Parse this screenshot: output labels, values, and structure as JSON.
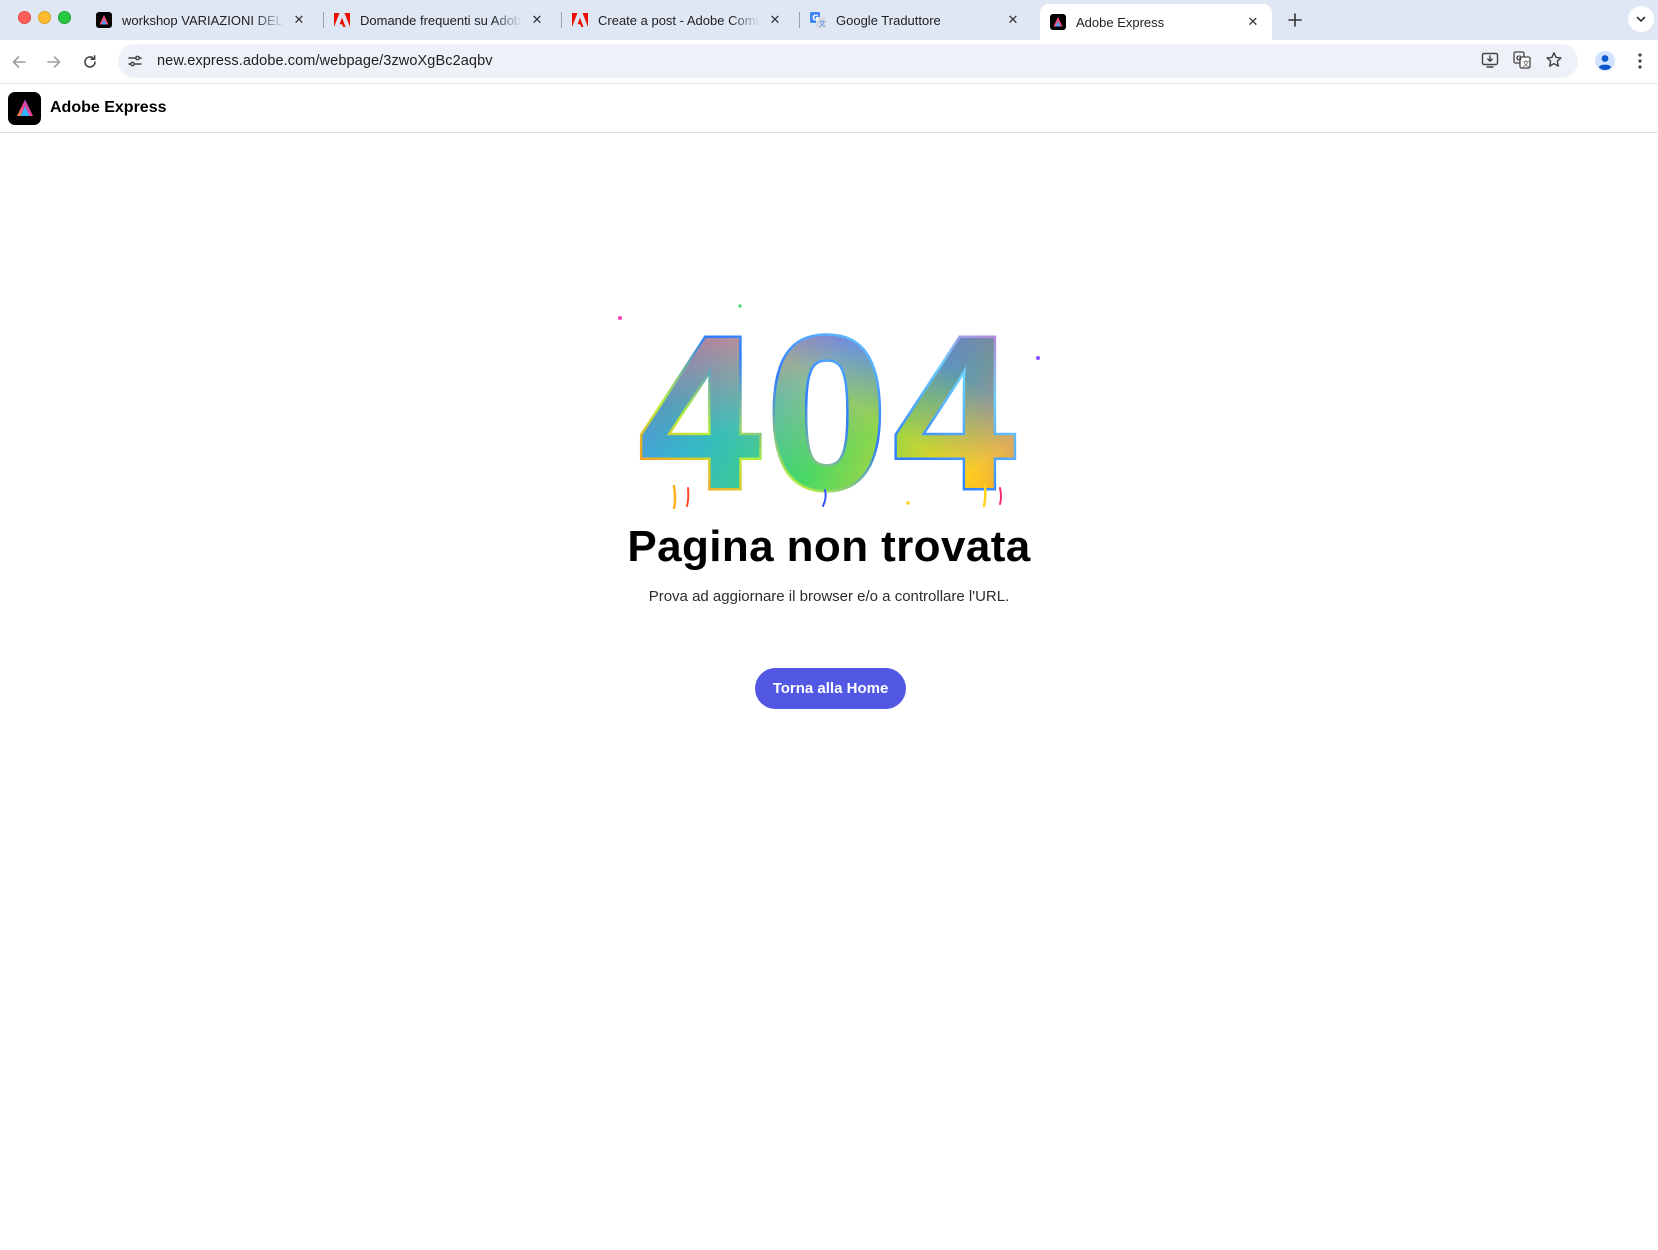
{
  "browser": {
    "tabs": [
      {
        "title": "workshop VARIAZIONI DEL PA",
        "favicon": "adobe-express-icon",
        "active": false
      },
      {
        "title": "Domande frequenti su Adobe",
        "favicon": "adobe-icon",
        "active": false
      },
      {
        "title": "Create a post - Adobe Comm",
        "favicon": "adobe-icon",
        "active": false
      },
      {
        "title": "Google Traduttore",
        "favicon": "google-translate-icon",
        "active": false
      },
      {
        "title": "Adobe Express",
        "favicon": "adobe-express-icon",
        "active": true
      }
    ],
    "url": "new.express.adobe.com/webpage/3zwoXgBc2aqbv"
  },
  "site": {
    "brand_name": "Adobe Express"
  },
  "error_page": {
    "code": "404",
    "heading": "Pagina non trovata",
    "message": "Prova ad aggiornare il browser e/o a controllare l'URL.",
    "button_label": "Torna alla Home"
  },
  "colors": {
    "tabstrip_bg": "#dfe6f4",
    "button_bg": "#5258e4",
    "adobe_red": "#eb1000"
  }
}
